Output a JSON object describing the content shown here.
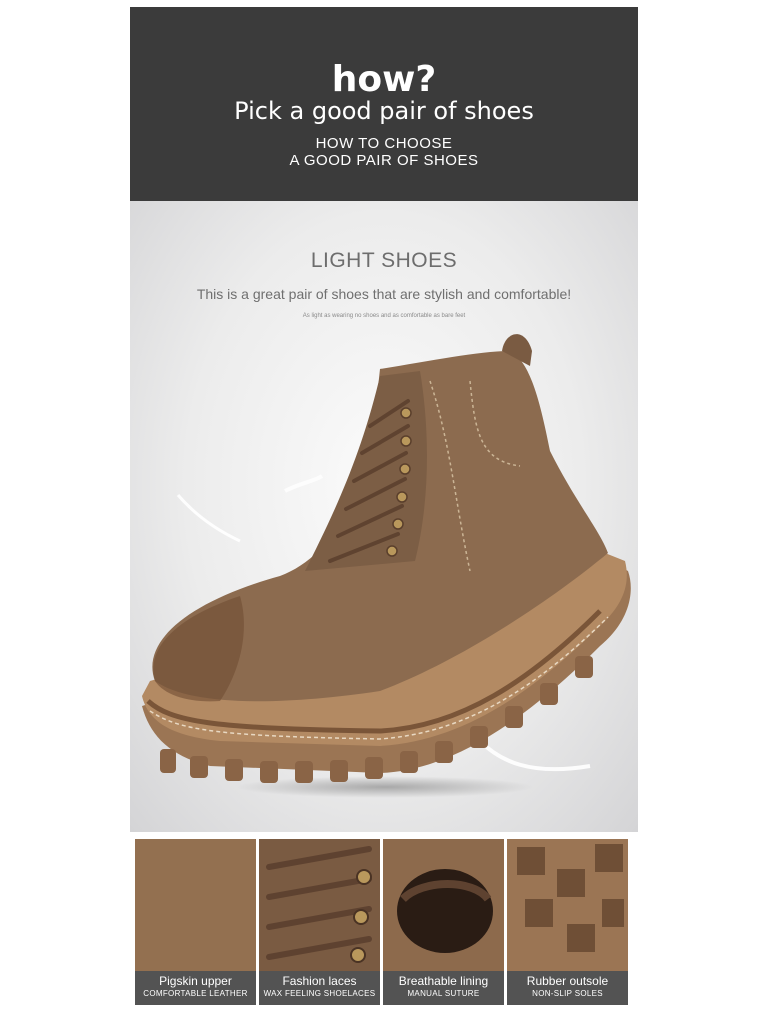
{
  "header": {
    "title": "how?",
    "subtitle": "Pick a good pair of shoes",
    "caption_line1": "HOW TO CHOOSE",
    "caption_line2": "A GOOD PAIR OF SHOES"
  },
  "hero": {
    "title": "LIGHT SHOES",
    "tagline": "This is a great pair of shoes that are stylish and comfortable!",
    "fine_print": "As light as wearing no shoes and as comfortable as bare feet"
  },
  "features": [
    {
      "title": "Pigskin upper",
      "subtitle": "COMFORTABLE LEATHER"
    },
    {
      "title": "Fashion laces",
      "subtitle": "WAX FEELING SHOELACES"
    },
    {
      "title": "Breathable lining",
      "subtitle": "MANUAL SUTURE"
    },
    {
      "title": "Rubber outsole",
      "subtitle": "NON-SLIP SOLES"
    }
  ],
  "colors": {
    "header_bg": "#3b3b3b",
    "suede": "#8c6b4f",
    "sole": "#a37a57",
    "label_bg": "#535353"
  }
}
